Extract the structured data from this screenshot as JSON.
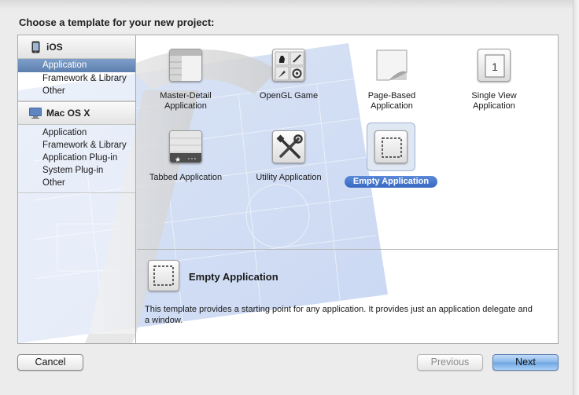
{
  "header": {
    "title": "Choose a template for your new project:"
  },
  "sidebar": {
    "groups": [
      {
        "title": "iOS",
        "icon": "iphone-icon",
        "items": [
          "Application",
          "Framework & Library",
          "Other"
        ],
        "selected_index": 0
      },
      {
        "title": "Mac OS X",
        "icon": "mac-os-x-icon",
        "items": [
          "Application",
          "Framework & Library",
          "Application Plug-in",
          "System Plug-in",
          "Other"
        ]
      }
    ]
  },
  "templates": [
    {
      "label": "Master-Detail\nApplication",
      "icon": "master-detail-icon"
    },
    {
      "label": "OpenGL Game",
      "icon": "opengl-game-icon"
    },
    {
      "label": "Page-Based\nApplication",
      "icon": "page-curl-icon"
    },
    {
      "label": "Single View\nApplication",
      "icon": "single-view-icon"
    },
    {
      "label": "Tabbed Application",
      "icon": "tabbed-app-icon"
    },
    {
      "label": "Utility Application",
      "icon": "utility-tools-icon"
    },
    {
      "label": "Empty Application",
      "icon": "empty-app-icon",
      "selected": true
    }
  ],
  "description": {
    "title": "Empty Application",
    "text": "This template provides a starting point for any application. It provides just an application delegate and a window."
  },
  "buttons": {
    "cancel": "Cancel",
    "previous": "Previous",
    "next": "Next"
  },
  "colors": {
    "selection_blue": "#3768c3",
    "default_button": "#86b6ea"
  }
}
